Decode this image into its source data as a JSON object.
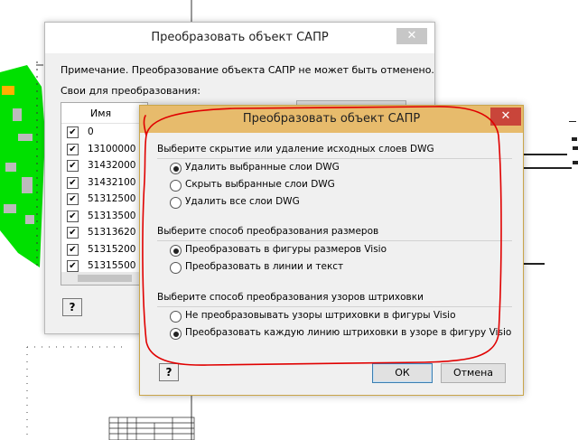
{
  "colors": {
    "accent_red": "#e00000",
    "title_orange": "#e7bb6c",
    "green_drawing": "#00e000"
  },
  "back_dialog": {
    "title": "Преобразовать объект САПР",
    "note": "Примечание. Преобразование объекта САПР не может быть отменено.",
    "props_label": "Свои для преобразования:",
    "list_header": "Имя",
    "layers": [
      "0",
      "13100000",
      "31432000",
      "31432100",
      "51312500",
      "51313500",
      "51313620",
      "51315200",
      "51315500"
    ],
    "help_icon": "?",
    "close_icon": "✕"
  },
  "front_dialog": {
    "title": "Преобразовать объект САПР",
    "close_icon": "✕",
    "section1": {
      "heading": "Выберите скрытие или удаление исходных слоев DWG",
      "options": [
        "Удалить выбранные слои DWG",
        "Скрыть выбранные слои DWG",
        "Удалить все слои DWG"
      ],
      "selected": 0
    },
    "section2": {
      "heading": "Выберите способ преобразования размеров",
      "options": [
        "Преобразовать в фигуры размеров Visio",
        "Преобразовать в линии и текст"
      ],
      "selected": 0
    },
    "section3": {
      "heading": "Выберите способ преобразования узоров штриховки",
      "options": [
        "Не преобразовывать узоры штриховки в фигуры Visio",
        "Преобразовать каждую линию штриховки в узоре в фигуру Visio"
      ],
      "selected": 1
    },
    "help_icon": "?",
    "ok_label": "ОК",
    "cancel_label": "Отмена"
  }
}
